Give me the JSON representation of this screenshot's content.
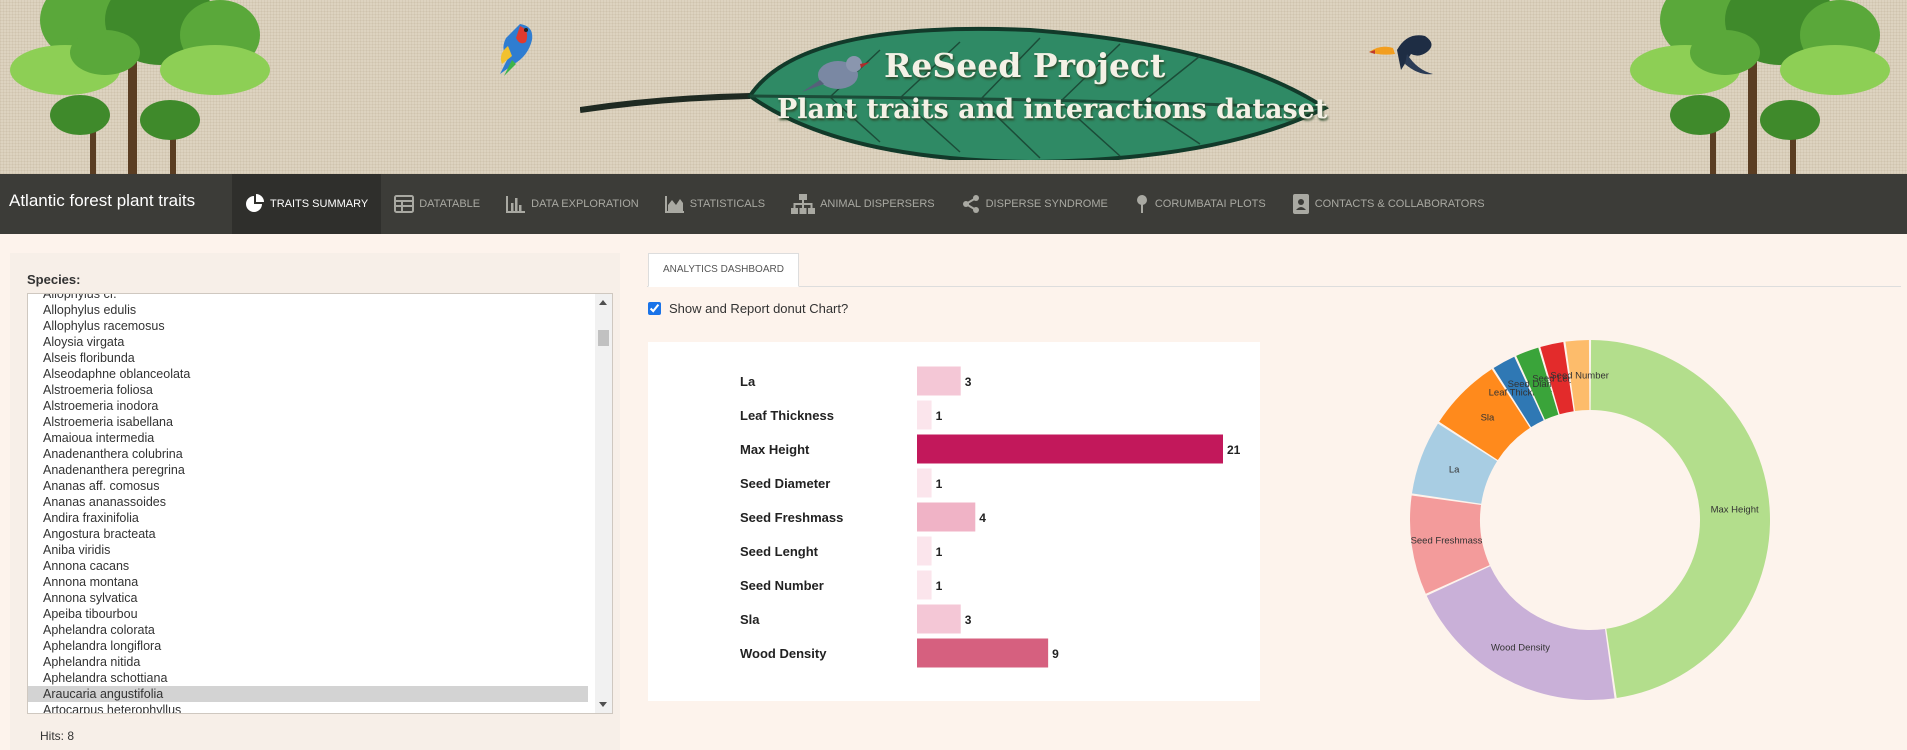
{
  "banner": {
    "title": "ReSeed Project",
    "subtitle": "Plant traits and interactions dataset"
  },
  "navbar": {
    "brand": "Atlantic forest plant traits",
    "tabs": [
      {
        "label": "TRAITS SUMMARY",
        "icon": "pie-chart-icon",
        "active": true
      },
      {
        "label": "DATATABLE",
        "icon": "table-icon",
        "active": false
      },
      {
        "label": "DATA EXPLORATION",
        "icon": "bar-chart-icon",
        "active": false
      },
      {
        "label": "STATISTICALS",
        "icon": "area-chart-icon",
        "active": false
      },
      {
        "label": "ANIMAL DISPERSERS",
        "icon": "sitemap-icon",
        "active": false
      },
      {
        "label": "DISPERSE SYNDROME",
        "icon": "share-icon",
        "active": false
      },
      {
        "label": "CORUMBATAI PLOTS",
        "icon": "map-pin-icon",
        "active": false
      },
      {
        "label": "CONTACTS & COLLABORATORS",
        "icon": "contact-card-icon",
        "active": false
      }
    ]
  },
  "sidebar": {
    "species_label": "Species:",
    "species": [
      "Allophylus cf.",
      "Allophylus edulis",
      "Allophylus racemosus",
      "Aloysia virgata",
      "Alseis floribunda",
      "Alseodaphne oblanceolata",
      "Alstroemeria foliosa",
      "Alstroemeria inodora",
      "Alstroemeria isabellana",
      "Amaioua intermedia",
      "Anadenanthera colubrina",
      "Anadenanthera peregrina",
      "Ananas aff. comosus",
      "Ananas ananassoides",
      "Andira fraxinifolia",
      "Angostura bracteata",
      "Aniba viridis",
      "Annona cacans",
      "Annona montana",
      "Annona sylvatica",
      "Apeiba tibourbou",
      "Aphelandra colorata",
      "Aphelandra longiflora",
      "Aphelandra nitida",
      "Aphelandra schottiana",
      "Araucaria angustifolia",
      "Artocarpus heterophyllus"
    ],
    "selected_species": "Araucaria angustifolia",
    "hits": "Hits: 8"
  },
  "main": {
    "tab_label": "ANALYTICS DASHBOARD",
    "checkbox_label": "Show and Report donut Chart?",
    "checkbox_checked": true
  },
  "chart_data": [
    {
      "type": "bar",
      "orientation": "horizontal",
      "categories": [
        "La",
        "Leaf Thickness",
        "Max Height",
        "Seed Diameter",
        "Seed Freshmass",
        "Seed Lenght",
        "Seed Number",
        "Sla",
        "Wood Density"
      ],
      "values": [
        3,
        1,
        21,
        1,
        4,
        1,
        1,
        3,
        9
      ],
      "colors": [
        "#f4c7d6",
        "#fbe5ec",
        "#c2185b",
        "#fbe5ec",
        "#f0b3c6",
        "#fbe5ec",
        "#fbe5ec",
        "#f4c7d6",
        "#d6607f"
      ],
      "xlim": [
        0,
        21
      ]
    },
    {
      "type": "pie",
      "donut": true,
      "slices": [
        {
          "label": "Max Height",
          "value": 21,
          "color": "#b3de8c"
        },
        {
          "label": "Wood Density",
          "value": 9,
          "color": "#c9b0d8"
        },
        {
          "label": "Seed Freshmass",
          "value": 4,
          "color": "#f39b9b"
        },
        {
          "label": "La",
          "value": 3,
          "color": "#a8cde3"
        },
        {
          "label": "Sla",
          "value": 3,
          "color": "#ff8a1c"
        },
        {
          "label": "Leaf Thickness",
          "value": 1,
          "color": "#2f78b4"
        },
        {
          "label": "Seed Diameter",
          "value": 1,
          "color": "#3aa43a"
        },
        {
          "label": "Seed Lenght",
          "value": 1,
          "color": "#e32b2b"
        },
        {
          "label": "Seed Number",
          "value": 1,
          "color": "#fdbc6b"
        }
      ]
    }
  ]
}
